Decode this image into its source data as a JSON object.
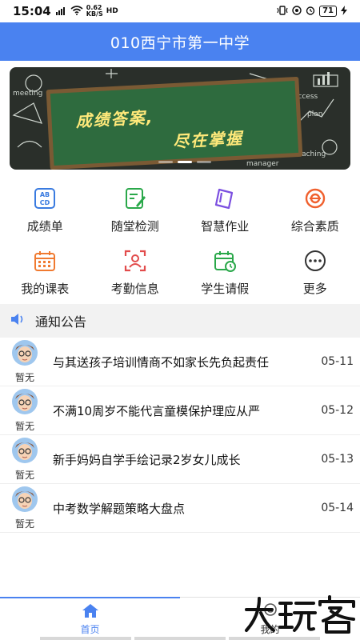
{
  "status_bar": {
    "time": "15:04",
    "network_left": "4G",
    "network_speed": "0.62",
    "network_unit": "KB/S",
    "hd": "HD",
    "battery": "71"
  },
  "header": {
    "title": "010西宁市第一中学"
  },
  "banner": {
    "line1": "成绩答案,",
    "line2": "尽在掌握",
    "doodle_words": [
      "meeting",
      "success",
      "plan",
      "teaching",
      "manager"
    ],
    "dots": 3,
    "active_dot": 1
  },
  "grid": {
    "items": [
      {
        "label": "成绩单",
        "icon": "abcd-icon",
        "color": "#3a7be0"
      },
      {
        "label": "随堂检测",
        "icon": "edit-sheet-icon",
        "color": "#2aa84a"
      },
      {
        "label": "智慧作业",
        "icon": "homework-icon",
        "color": "#7b4fe0"
      },
      {
        "label": "综合素质",
        "icon": "target-icon",
        "color": "#f0602e"
      },
      {
        "label": "我的课表",
        "icon": "calendar-icon",
        "color": "#f07a30"
      },
      {
        "label": "考勤信息",
        "icon": "attendance-icon",
        "color": "#e24c4c"
      },
      {
        "label": "学生请假",
        "icon": "leave-calendar-icon",
        "color": "#2aa84a"
      },
      {
        "label": "更多",
        "icon": "more-icon",
        "color": "#333333"
      }
    ]
  },
  "notice": {
    "label": "通知公告",
    "icon": "speaker-icon",
    "icon_color": "#4a82f0"
  },
  "news": [
    {
      "author": "暂无",
      "title": "与其送孩子培训情商不如家长先负起责任",
      "date": "05-11"
    },
    {
      "author": "暂无",
      "title": "不满10周岁不能代言童模保护理应从严",
      "date": "05-12"
    },
    {
      "author": "暂无",
      "title": "新手妈妈自学手绘记录2岁女儿成长",
      "date": "05-13"
    },
    {
      "author": "暂无",
      "title": "中考数学解题策略大盘点",
      "date": "05-14"
    }
  ],
  "tab_bar": {
    "tabs": [
      {
        "label": "首页",
        "icon": "home-icon",
        "active": true
      },
      {
        "label": "我的",
        "icon": "user-icon",
        "active": false
      }
    ],
    "accent": "#4a82f0"
  },
  "watermark": {
    "text": "大玩客"
  }
}
